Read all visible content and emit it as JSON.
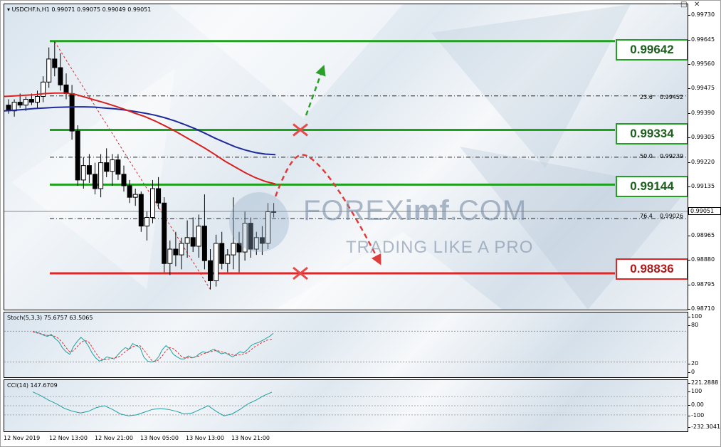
{
  "chart_header": {
    "symbol": "USDCHF.h,H1",
    "ohlc": "0.99071 0.99075 0.99049 0.99051"
  },
  "price_scale": [
    "0.99730",
    "0.99645",
    "0.99560",
    "0.99475",
    "0.99390",
    "0.99305",
    "0.99220",
    "0.99135",
    "0.99051",
    "0.98965",
    "0.98880",
    "0.98795",
    "0.98710"
  ],
  "current_price": "0.99051",
  "levels": {
    "top_green": "0.99642",
    "mid_green": "0.99334",
    "low_green": "0.99144",
    "red": "0.98836"
  },
  "fib_labels": [
    {
      "ratio": "23.6",
      "value": "0.99452"
    },
    {
      "ratio": "50.0",
      "value": "0.99239"
    },
    {
      "ratio": "76.4",
      "value": "0.99026"
    }
  ],
  "watermark": {
    "title_a": "FOREX",
    "title_b": "imf",
    "title_c": ".COM",
    "subtitle": "TRADING LIKE A PRO"
  },
  "stoch": {
    "label": "Stoch(5,3,3) 75.6757 63.5065",
    "scale": [
      "100",
      "80",
      "20",
      "0"
    ]
  },
  "cci": {
    "label": "CCI(14) 147.6709",
    "scale": [
      "221.2888",
      "100",
      "0.00",
      "-100",
      "-232.3041"
    ]
  },
  "time_axis": [
    "12 Nov 2019",
    "12 Nov 13:00",
    "12 Nov 21:00",
    "13 Nov 05:00",
    "13 Nov 13:00",
    "13 Nov 21:00"
  ],
  "colors": {
    "green_line": "#1fa01f",
    "red_line": "#e42525",
    "ma_red": "#d82020",
    "ma_blue": "#1e2a98",
    "arrow_green": "#2aa02a",
    "arrow_red": "#e03c3c"
  },
  "chart_data": {
    "type": "candlestick",
    "symbol": "USDCHF.h",
    "timeframe": "H1",
    "ylim": [
      0.9871,
      0.9977
    ],
    "candles": [
      {
        "o": 0.9942,
        "h": 0.9944,
        "l": 0.9939,
        "c": 0.994
      },
      {
        "o": 0.994,
        "h": 0.9944,
        "l": 0.9938,
        "c": 0.9943
      },
      {
        "o": 0.9943,
        "h": 0.9946,
        "l": 0.9941,
        "c": 0.9942
      },
      {
        "o": 0.9942,
        "h": 0.9945,
        "l": 0.994,
        "c": 0.9944
      },
      {
        "o": 0.9944,
        "h": 0.9946,
        "l": 0.9942,
        "c": 0.9943
      },
      {
        "o": 0.9943,
        "h": 0.9947,
        "l": 0.9941,
        "c": 0.9945
      },
      {
        "o": 0.9945,
        "h": 0.9952,
        "l": 0.9943,
        "c": 0.995
      },
      {
        "o": 0.995,
        "h": 0.9962,
        "l": 0.9948,
        "c": 0.9958
      },
      {
        "o": 0.9958,
        "h": 0.9964,
        "l": 0.9952,
        "c": 0.9955
      },
      {
        "o": 0.9955,
        "h": 0.996,
        "l": 0.9947,
        "c": 0.9949
      },
      {
        "o": 0.9949,
        "h": 0.9953,
        "l": 0.9944,
        "c": 0.9946
      },
      {
        "o": 0.9946,
        "h": 0.9949,
        "l": 0.993,
        "c": 0.9933
      },
      {
        "o": 0.9933,
        "h": 0.9935,
        "l": 0.9914,
        "c": 0.9916
      },
      {
        "o": 0.9916,
        "h": 0.9924,
        "l": 0.9913,
        "c": 0.9921
      },
      {
        "o": 0.9921,
        "h": 0.9925,
        "l": 0.9915,
        "c": 0.9918
      },
      {
        "o": 0.9918,
        "h": 0.9922,
        "l": 0.9911,
        "c": 0.9913
      },
      {
        "o": 0.9913,
        "h": 0.9925,
        "l": 0.991,
        "c": 0.9922
      },
      {
        "o": 0.9922,
        "h": 0.9927,
        "l": 0.9917,
        "c": 0.9919
      },
      {
        "o": 0.9919,
        "h": 0.9925,
        "l": 0.9914,
        "c": 0.9923
      },
      {
        "o": 0.9923,
        "h": 0.9925,
        "l": 0.9916,
        "c": 0.9918
      },
      {
        "o": 0.9918,
        "h": 0.9921,
        "l": 0.9912,
        "c": 0.9914
      },
      {
        "o": 0.9914,
        "h": 0.9916,
        "l": 0.9908,
        "c": 0.991
      },
      {
        "o": 0.991,
        "h": 0.9913,
        "l": 0.9907,
        "c": 0.9911
      },
      {
        "o": 0.9911,
        "h": 0.9912,
        "l": 0.9898,
        "c": 0.99
      },
      {
        "o": 0.99,
        "h": 0.9905,
        "l": 0.9895,
        "c": 0.9903
      },
      {
        "o": 0.9903,
        "h": 0.9916,
        "l": 0.9901,
        "c": 0.9913
      },
      {
        "o": 0.9913,
        "h": 0.9917,
        "l": 0.9906,
        "c": 0.9908
      },
      {
        "o": 0.9908,
        "h": 0.991,
        "l": 0.9884,
        "c": 0.9887
      },
      {
        "o": 0.9887,
        "h": 0.9895,
        "l": 0.9883,
        "c": 0.9892
      },
      {
        "o": 0.9892,
        "h": 0.9898,
        "l": 0.9886,
        "c": 0.989
      },
      {
        "o": 0.989,
        "h": 0.9896,
        "l": 0.9885,
        "c": 0.9894
      },
      {
        "o": 0.9894,
        "h": 0.9902,
        "l": 0.9889,
        "c": 0.9896
      },
      {
        "o": 0.9896,
        "h": 0.9903,
        "l": 0.9891,
        "c": 0.9893
      },
      {
        "o": 0.9893,
        "h": 0.9904,
        "l": 0.9889,
        "c": 0.99
      },
      {
        "o": 0.99,
        "h": 0.9911,
        "l": 0.9885,
        "c": 0.9888
      },
      {
        "o": 0.9888,
        "h": 0.9892,
        "l": 0.9878,
        "c": 0.9881
      },
      {
        "o": 0.9881,
        "h": 0.9897,
        "l": 0.9879,
        "c": 0.9894
      },
      {
        "o": 0.9894,
        "h": 0.9898,
        "l": 0.9885,
        "c": 0.9887
      },
      {
        "o": 0.9887,
        "h": 0.9892,
        "l": 0.9884,
        "c": 0.989
      },
      {
        "o": 0.989,
        "h": 0.991,
        "l": 0.9885,
        "c": 0.9894
      },
      {
        "o": 0.9894,
        "h": 0.9898,
        "l": 0.9884,
        "c": 0.9891
      },
      {
        "o": 0.9891,
        "h": 0.9905,
        "l": 0.9888,
        "c": 0.9901
      },
      {
        "o": 0.9901,
        "h": 0.9903,
        "l": 0.9889,
        "c": 0.9892
      },
      {
        "o": 0.9892,
        "h": 0.9898,
        "l": 0.989,
        "c": 0.9896
      },
      {
        "o": 0.9896,
        "h": 0.99,
        "l": 0.989,
        "c": 0.9894
      },
      {
        "o": 0.9894,
        "h": 0.9908,
        "l": 0.9892,
        "c": 0.9905
      },
      {
        "o": 0.9905,
        "h": 0.9908,
        "l": 0.9903,
        "c": 0.9905
      }
    ],
    "ma_red": [
      0.9945,
      0.99452,
      0.99454,
      0.99456,
      0.9946,
      0.99462,
      0.99462,
      0.99458,
      0.99448,
      0.99438,
      0.99428,
      0.99417,
      0.99405,
      0.99392,
      0.9938,
      0.99365,
      0.99348,
      0.9933,
      0.9931,
      0.9929,
      0.9927,
      0.99248,
      0.99225,
      0.99205,
      0.99185,
      0.99168,
      0.99155,
      0.99146
    ],
    "ma_blue": [
      0.994,
      0.99402,
      0.99405,
      0.99408,
      0.9941,
      0.99412,
      0.99413,
      0.99414,
      0.99414,
      0.99413,
      0.9941,
      0.99407,
      0.99403,
      0.99398,
      0.99392,
      0.99385,
      0.99376,
      0.99365,
      0.99352,
      0.99338,
      0.99322,
      0.99305,
      0.9929,
      0.99275,
      0.99264,
      0.99255,
      0.9925,
      0.99248
    ],
    "stoch_k": [
      80,
      78,
      76,
      72,
      70,
      74,
      66,
      60,
      48,
      40,
      35,
      50,
      60,
      68,
      62,
      52,
      38,
      28,
      22,
      24,
      30,
      28,
      26,
      34,
      42,
      48,
      45,
      56,
      52,
      48,
      30,
      22,
      20,
      22,
      30,
      44,
      52,
      46,
      35,
      30,
      26,
      26,
      32,
      28,
      30,
      36,
      40,
      38,
      42,
      45,
      40,
      36,
      38,
      34,
      30,
      35,
      40,
      38,
      44,
      52,
      56,
      58,
      62,
      66,
      70,
      76
    ],
    "stoch_d": [
      79,
      77,
      75,
      74,
      72,
      72,
      70,
      66,
      58,
      48,
      40,
      42,
      50,
      58,
      62,
      60,
      50,
      38,
      28,
      24,
      25,
      27,
      28,
      29,
      34,
      40,
      45,
      50,
      52,
      52,
      44,
      34,
      24,
      21,
      24,
      32,
      42,
      48,
      46,
      40,
      32,
      28,
      28,
      29,
      30,
      32,
      36,
      38,
      40,
      42,
      42,
      40,
      38,
      36,
      34,
      33,
      34,
      36,
      38,
      44,
      50,
      54,
      58,
      62,
      64,
      64
    ]
  }
}
